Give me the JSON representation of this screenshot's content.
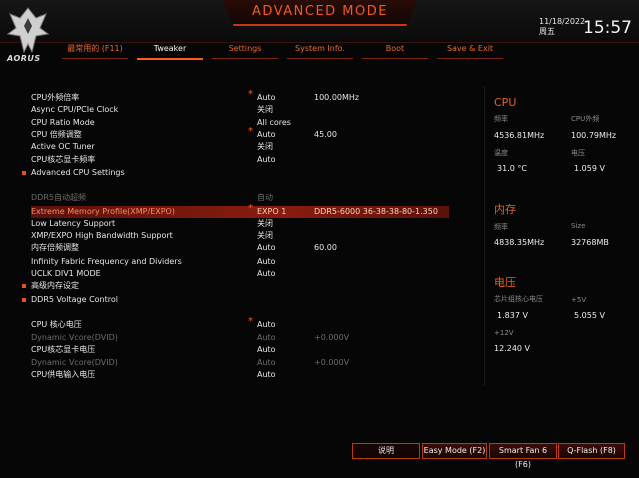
{
  "header": {
    "brand": "AORUS",
    "mode_title": "ADVANCED MODE",
    "date": "11/18/2022",
    "weekday": "周五",
    "time": "15:57"
  },
  "tabs": [
    {
      "label": "最常用的 (F11)",
      "active": false
    },
    {
      "label": "Tweaker",
      "active": true
    },
    {
      "label": "Settings",
      "active": false
    },
    {
      "label": "System Info.",
      "active": false
    },
    {
      "label": "Boot",
      "active": false
    },
    {
      "label": "Save & Exit",
      "active": false
    }
  ],
  "settings": [
    {
      "label": "CPU外频倍率",
      "value": "Auto",
      "value2": "100.00MHz",
      "star": true
    },
    {
      "label": "Async CPU/PCIe Clock",
      "value": "关闭"
    },
    {
      "label": "CPU Ratio Mode",
      "value": "All cores"
    },
    {
      "label": "CPU 倍频调整",
      "value": "Auto",
      "value2": "45.00",
      "star": true
    },
    {
      "label": "Active OC Tuner",
      "value": "关闭"
    },
    {
      "label": "CPU核芯显卡频率",
      "value": "Auto"
    },
    {
      "label": "Advanced CPU Settings",
      "bullet": true
    },
    {
      "label": "DDR5自动超频",
      "value": "自动",
      "dim": true
    },
    {
      "label": "Extreme Memory Profile(XMP/EXPO)",
      "value": "EXPO 1",
      "value2": "DDR5-6000 36-38-38-80-1.350",
      "star": true,
      "highlight": true
    },
    {
      "label": "Low Latency Support",
      "value": "关闭"
    },
    {
      "label": "XMP/EXPO High Bandwidth Support",
      "value": "关闭"
    },
    {
      "label": "内存倍频调整",
      "value": "Auto",
      "value2": "60.00"
    },
    {
      "label": "Infinity Fabric Frequency and Dividers",
      "value": "Auto"
    },
    {
      "label": "UCLK DIV1 MODE",
      "value": "Auto"
    },
    {
      "label": "高级内存设定",
      "bullet": true
    },
    {
      "label": "DDR5 Voltage Control",
      "bullet": true
    },
    {
      "label": "CPU 核心电压",
      "value": "Auto",
      "star": true
    },
    {
      "label": "Dynamic Vcore(DVID)",
      "value": "Auto",
      "value2": "+0.000V",
      "dim": true
    },
    {
      "label": "CPU核芯显卡电压",
      "value": "Auto"
    },
    {
      "label": "Dynamic Vcore(DVID)",
      "value": "Auto",
      "value2": "+0.000V",
      "dim": true
    },
    {
      "label": "CPU供电输入电压",
      "value": "Auto"
    }
  ],
  "sidebar": {
    "cpu": {
      "title": "CPU",
      "freq_label": "频率",
      "freq_value": "4536.81MHz",
      "bclk_label": "CPU外频",
      "bclk_value": "100.79MHz",
      "temp_label": "温度",
      "temp_value": "31.0 °C",
      "volt_label": "电压",
      "volt_value": "1.059 V"
    },
    "memory": {
      "title": "内存",
      "freq_label": "频率",
      "freq_value": "4838.35MHz",
      "size_label": "Size",
      "size_value": "32768MB"
    },
    "voltage": {
      "title": "电压",
      "soc_label": "芯片组核心电压",
      "soc_value": "1.837 V",
      "v5_label": "+5V",
      "v5_value": "5.055 V",
      "v12_label": "+12V",
      "v12_value": "12.240 V"
    }
  },
  "buttons": {
    "help": "说明",
    "easy": "Easy Mode (F2)",
    "smartfan": "Smart Fan 6 (F6)",
    "qflash": "Q-Flash (F8)"
  },
  "colors": {
    "accent": "#ff5a1a",
    "highlight": "#8a1c0e",
    "background": "#060606"
  }
}
